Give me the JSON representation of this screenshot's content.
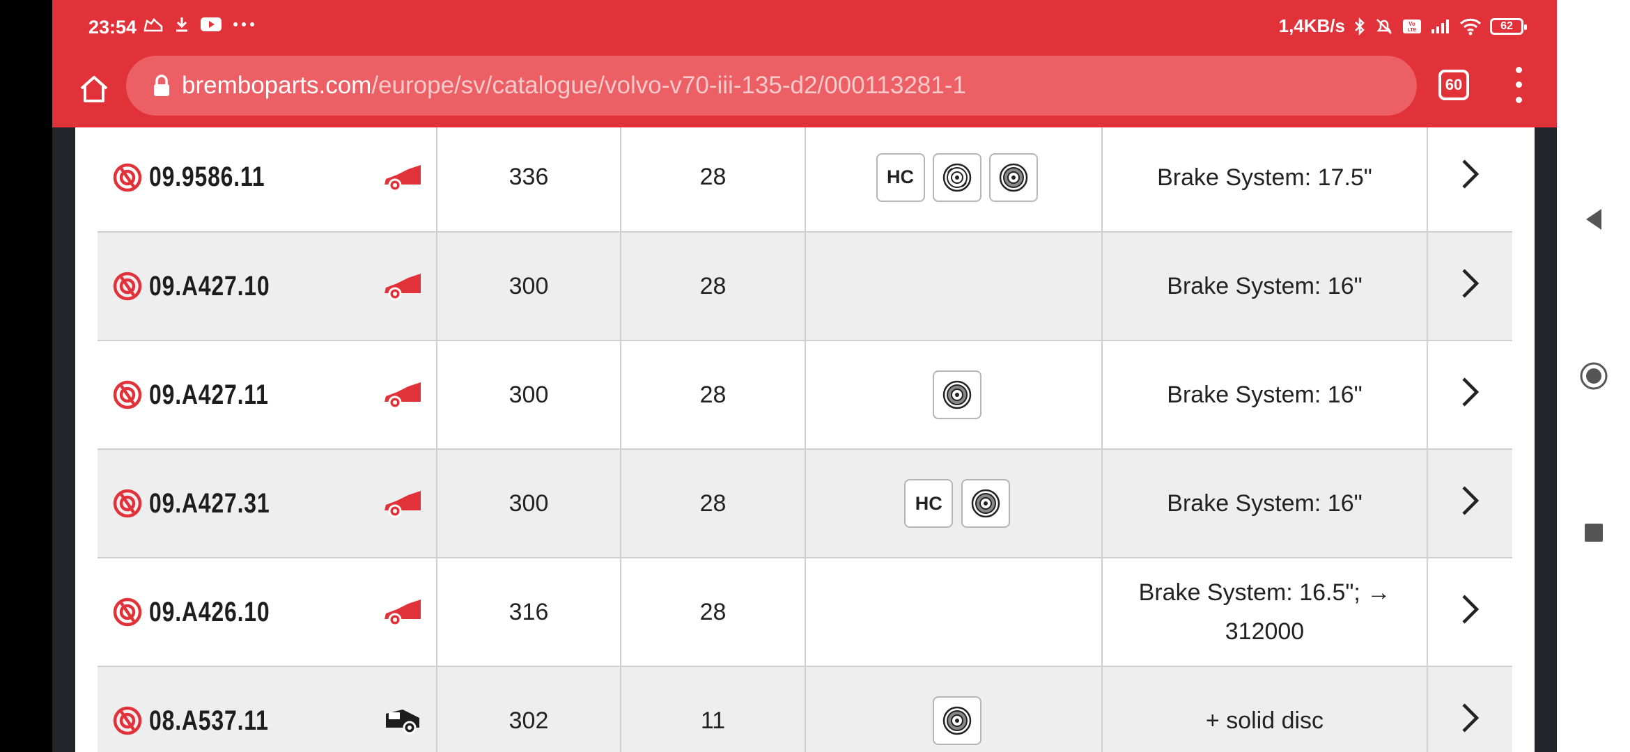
{
  "status_bar": {
    "time": "23:54",
    "network_speed": "1,4KB/s",
    "battery": "62",
    "left_icons": [
      "sneaker-icon",
      "download-icon",
      "youtube-icon",
      "more-dots-icon"
    ],
    "right_icons": [
      "bluetooth-icon",
      "mute-icon",
      "volte-icon",
      "signal-icon",
      "wifi-icon"
    ]
  },
  "browser": {
    "url_domain": "bremboparts.com",
    "url_path": "/europe/sv/catalogue/volvo-v70-iii-135-d2/000113281-1",
    "tab_count": "60"
  },
  "table": {
    "rows": [
      {
        "code": "09.9586.11",
        "vehicle": "car-front-icon",
        "diameter": "336",
        "thickness": "28",
        "badges": [
          "hc",
          "drilled-disc",
          "disc"
        ],
        "notes": "Brake System: 17.5\""
      },
      {
        "code": "09.A427.10",
        "vehicle": "car-front-icon",
        "diameter": "300",
        "thickness": "28",
        "badges": [],
        "notes": "Brake System: 16\""
      },
      {
        "code": "09.A427.11",
        "vehicle": "car-front-icon",
        "diameter": "300",
        "thickness": "28",
        "badges": [
          "disc"
        ],
        "notes": "Brake System: 16\""
      },
      {
        "code": "09.A427.31",
        "vehicle": "car-front-icon",
        "diameter": "300",
        "thickness": "28",
        "badges": [
          "hc",
          "disc"
        ],
        "notes": "Brake System: 16\""
      },
      {
        "code": "09.A426.10",
        "vehicle": "car-front-icon",
        "diameter": "316",
        "thickness": "28",
        "badges": [],
        "notes": "Brake System: 16.5\"; →",
        "notes_line2": "312000"
      },
      {
        "code": "08.A537.11",
        "vehicle": "car-rear-icon",
        "diameter": "302",
        "thickness": "11",
        "badges": [
          "disc"
        ],
        "notes": "+ solid disc"
      }
    ],
    "badge_hc_label": "HC"
  },
  "colors": {
    "brand_red": "#e1323a",
    "url_bar": "#ec6065",
    "row_alt": "#eeeeee"
  }
}
